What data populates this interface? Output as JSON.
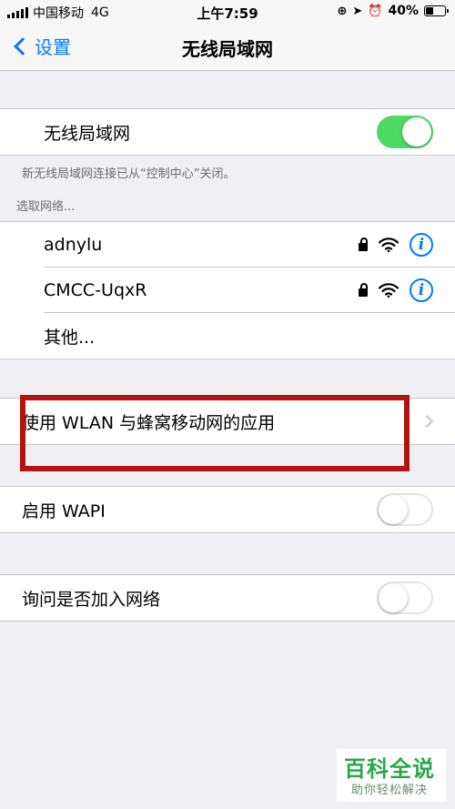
{
  "status_bar": {
    "carrier": "中国移动",
    "network": "4G",
    "time": "上午7:59",
    "battery": "40%",
    "battery_level": 0.4
  },
  "nav": {
    "back_label": "设置",
    "title": "无线局域网"
  },
  "wlan": {
    "label": "无线局域网",
    "enabled": true,
    "footnote": "新无线局域网连接已从“控制中心”关闭。"
  },
  "networks_header": "选取网络...",
  "networks": [
    {
      "name": "adnylu"
    },
    {
      "name": "CMCC-UqxR"
    }
  ],
  "other_label": "其他...",
  "apps_row": {
    "label": "使用 WLAN 与蜂窝移动网的应用"
  },
  "wapi": {
    "label": "启用 WAPI",
    "enabled": false
  },
  "ask_join": {
    "label": "询问是否加入网络",
    "enabled": false
  },
  "watermark": {
    "title": "百科全说",
    "subtitle": "助你轻松解决"
  },
  "colors": {
    "accent": "#007aff",
    "switch_on": "#4cd964",
    "highlight": "#b3130f"
  }
}
